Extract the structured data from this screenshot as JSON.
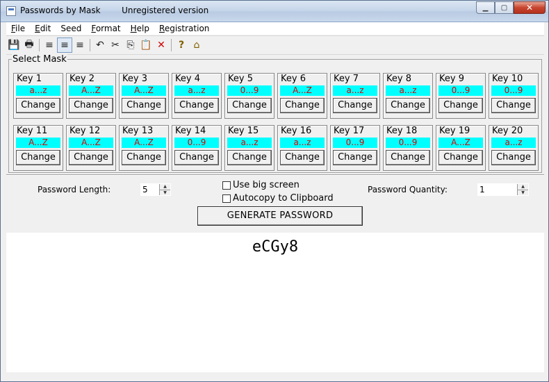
{
  "window": {
    "title": "Passwords by Mask        Unregistered version",
    "minimize": "▁",
    "maximize": "▢",
    "close": "✕"
  },
  "menu": [
    {
      "first": "F",
      "rest": "ile"
    },
    {
      "first": "E",
      "rest": "dit"
    },
    {
      "first": "",
      "rest": "Seed"
    },
    {
      "first": "F",
      "rest": "ormat"
    },
    {
      "first": "H",
      "rest": "elp"
    },
    {
      "first": "R",
      "rest": "egistration"
    }
  ],
  "toolbar": {
    "icons": [
      "save-icon",
      "print-icon",
      "align-left-icon",
      "align-center-icon",
      "align-right-icon",
      "undo-icon",
      "cut-icon",
      "copy-icon",
      "paste-icon",
      "delete-icon",
      "help-icon",
      "home-icon"
    ],
    "glyphs": [
      "💾",
      "🖶",
      "≡",
      "≡",
      "≡",
      "↶",
      "✂",
      "⎘",
      "📋",
      "✕",
      "?",
      "⌂"
    ],
    "delete_color": "#d00000"
  },
  "mask": {
    "title": "Select Mask",
    "change_label": "Change",
    "range_bg": "#00ffff",
    "range_color": "#e00000",
    "keys": [
      {
        "label": "Key 1",
        "range": "a...z"
      },
      {
        "label": "Key 2",
        "range": "A...Z"
      },
      {
        "label": "Key 3",
        "range": "A...Z"
      },
      {
        "label": "Key 4",
        "range": "a...z"
      },
      {
        "label": "Key 5",
        "range": "0...9"
      },
      {
        "label": "Key 6",
        "range": "A...Z"
      },
      {
        "label": "Key 7",
        "range": "a...z"
      },
      {
        "label": "Key 8",
        "range": "a...z"
      },
      {
        "label": "Key 9",
        "range": "0...9"
      },
      {
        "label": "Key 10",
        "range": "0...9"
      },
      {
        "label": "Key 11",
        "range": "A...Z"
      },
      {
        "label": "Key 12",
        "range": "A...Z"
      },
      {
        "label": "Key 13",
        "range": "A...Z"
      },
      {
        "label": "Key 14",
        "range": "0...9"
      },
      {
        "label": "Key 15",
        "range": "a...z"
      },
      {
        "label": "Key 16",
        "range": "a...z"
      },
      {
        "label": "Key 17",
        "range": "0...9"
      },
      {
        "label": "Key 18",
        "range": "0...9"
      },
      {
        "label": "Key 19",
        "range": "A...Z"
      },
      {
        "label": "Key 20",
        "range": "a...z"
      }
    ]
  },
  "options": {
    "length_label": "Password Length:",
    "length_value": "5",
    "quantity_label": "Password Quantity:",
    "quantity_value": "1",
    "big_screen_label": "Use big screen",
    "autocopy_label": "Autocopy to Clipboard",
    "generate_label": "GENERATE PASSWORD"
  },
  "output": {
    "password": "eCGy8"
  }
}
